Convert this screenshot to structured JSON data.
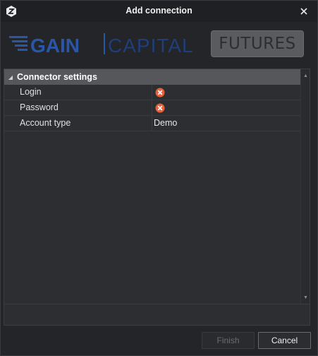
{
  "window": {
    "title": "Add connection",
    "close_icon": "close-icon"
  },
  "logo": {
    "gain": "GAIN",
    "capital": "CAPITAL",
    "futures": "FUTURES"
  },
  "grid": {
    "category_label": "Connector settings",
    "rows": [
      {
        "name": "Login",
        "value": "",
        "status": "error"
      },
      {
        "name": "Password",
        "value": "",
        "status": "error"
      },
      {
        "name": "Account type",
        "value": "Demo",
        "status": "ok"
      }
    ]
  },
  "buttons": {
    "finish": "Finish",
    "cancel": "Cancel"
  },
  "colors": {
    "error": "#e8613a",
    "logo_blue": "#2a56a8",
    "logo_blue_dark": "#1f3e7a"
  }
}
